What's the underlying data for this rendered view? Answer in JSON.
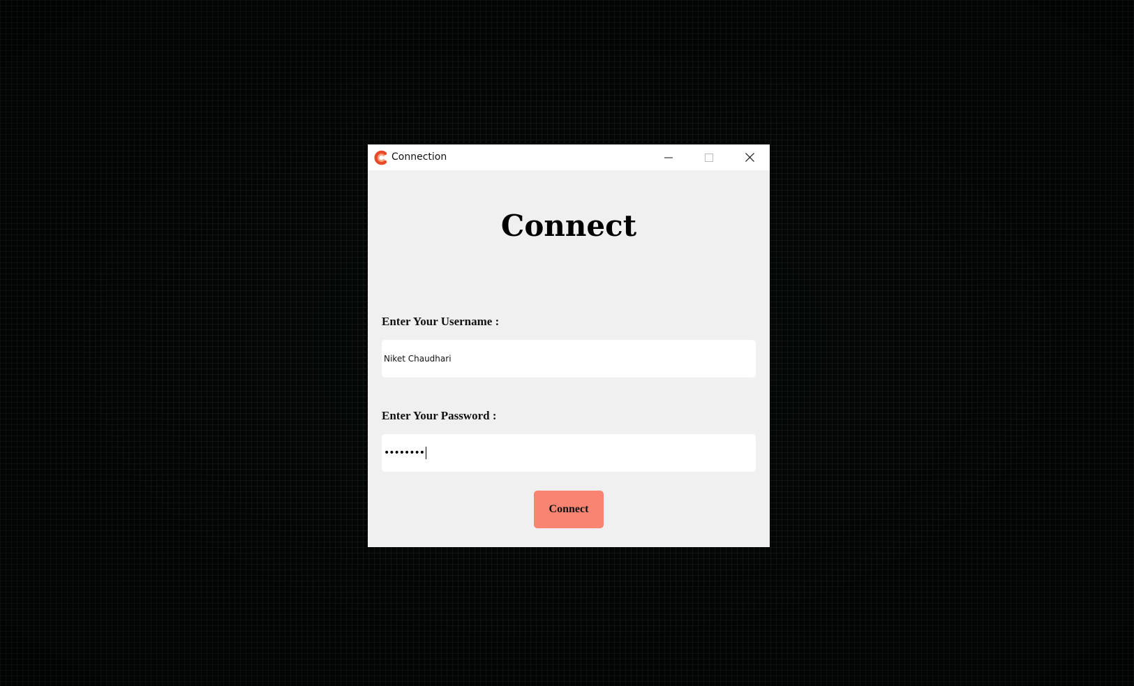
{
  "window": {
    "title": "Connection",
    "icon": "app-logo-icon",
    "controls": [
      "minimize-icon",
      "maximize-icon",
      "close-icon"
    ]
  },
  "main": {
    "heading": "Connect",
    "username": {
      "label": "Enter Your Username :",
      "value": "Niket Chaudhari"
    },
    "password": {
      "label": "Enter Your Password :",
      "masked_value": "••••••••"
    },
    "connect_button": "Connect"
  },
  "colors": {
    "accent": "#f88471",
    "window_bg": "#f0f0f0",
    "desktop_bg": "#050807"
  }
}
